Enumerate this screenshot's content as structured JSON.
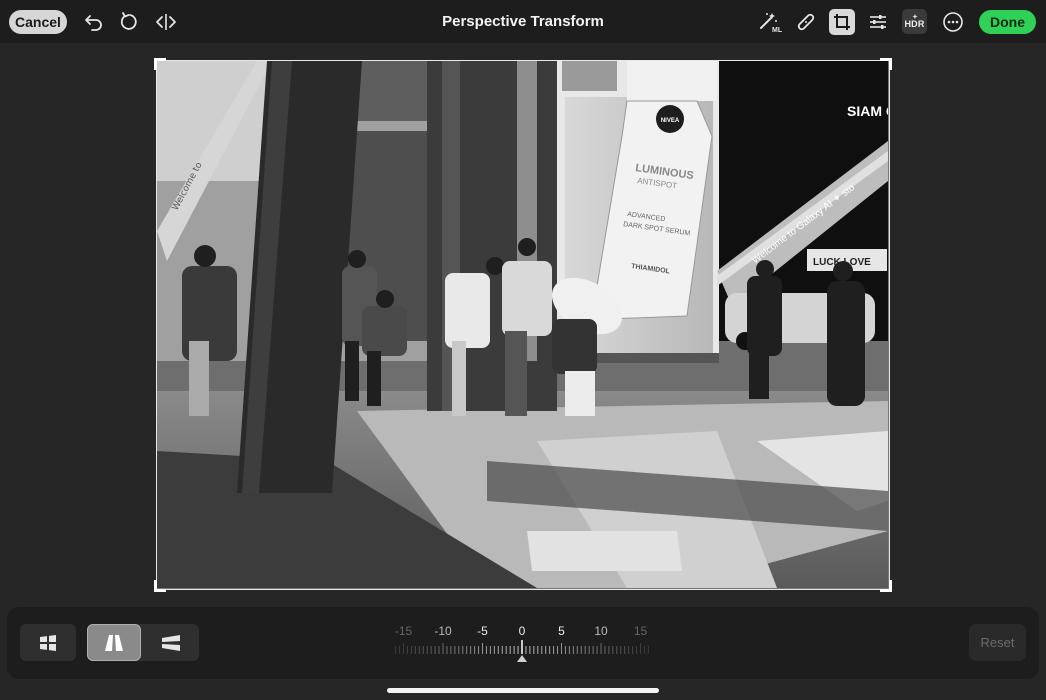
{
  "toolbar": {
    "cancel_label": "Cancel",
    "title": "Perspective Transform",
    "done_label": "Done",
    "hdr_label": "HDR",
    "ml_label": "ML",
    "icons": [
      "undo-icon",
      "rotate-icon",
      "compare-icon",
      "magic-wand-ml-icon",
      "bandage-icon",
      "crop-rotate-icon",
      "adjust-sliders-icon",
      "hdr-icon",
      "more-icon"
    ]
  },
  "canvas": {
    "photo_signs": {
      "brand": "NIVEA",
      "product_line1": "LUMINOUS",
      "product_line2": "ANTISPOT",
      "product_line3": "ADVANCED",
      "product_line4": "DARK SPOT SERUM",
      "ingredient": "THIAMIDOL",
      "escalator_banner": "Welcome to Galaxy AI ✦ sto",
      "mall_sign": "SIAM CE",
      "left_banner": "Welcome to",
      "shop_sign": "LUCK LOVE"
    }
  },
  "perspective": {
    "modes": [
      {
        "name": "auto",
        "icon": "auto-perspective-icon",
        "selected": false
      },
      {
        "name": "vertical",
        "icon": "vertical-perspective-icon",
        "selected": true
      },
      {
        "name": "horizontal",
        "icon": "horizontal-perspective-icon",
        "selected": false
      }
    ],
    "slider": {
      "value": 0,
      "min": -15,
      "max": 15,
      "labels": [
        "-15",
        "-10",
        "-5",
        "0",
        "5",
        "10",
        "15"
      ]
    },
    "reset_label": "Reset"
  },
  "colors": {
    "done_green": "#30d158",
    "panel_bg": "#1d1d1d",
    "canvas_bg": "#262626"
  }
}
